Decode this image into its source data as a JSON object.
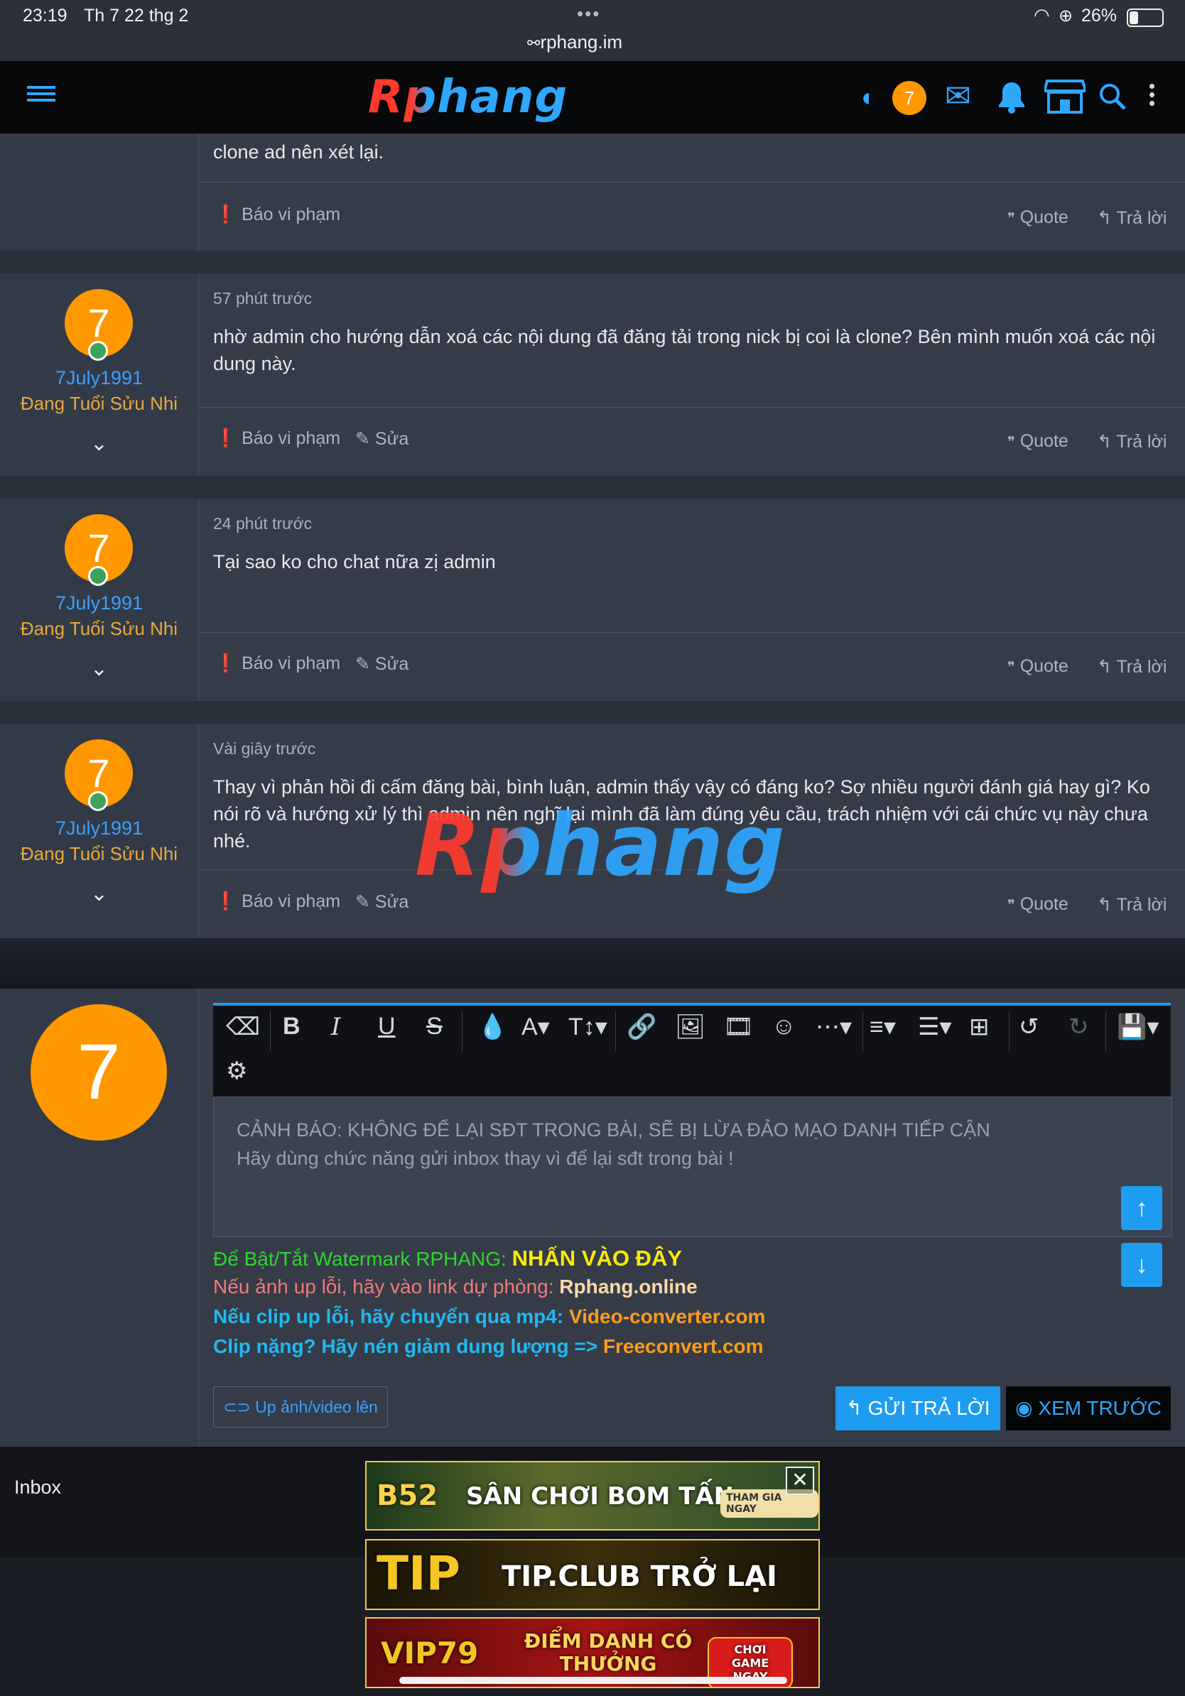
{
  "status_bar": {
    "time": "23:19",
    "date": "Th 7 22 thg 2",
    "url": "rphang.im",
    "battery": "26%"
  },
  "nav": {
    "logo": "Rphang",
    "notification_count": "7"
  },
  "top_post": {
    "content_tail": "clone ad nên xét lại.",
    "report": "Báo vi phạm",
    "quote": "Quote",
    "reply": "Trả lời"
  },
  "posts": [
    {
      "avatar": "7",
      "username": "7July1991",
      "user_title": "Đang Tuổi Sửu Nhi",
      "time": "57 phút trước",
      "content": "nhờ admin cho hướng dẫn xoá các nội dung đã đăng tải trong nick bị coi là clone? Bên mình muốn xoá các nội dung này.",
      "report": "Báo vi phạm",
      "edit": "Sửa",
      "quote": "Quote",
      "reply": "Trả lời"
    },
    {
      "avatar": "7",
      "username": "7July1991",
      "user_title": "Đang Tuổi Sửu Nhi",
      "time": "24 phút trước",
      "content": "Tại sao ko cho chat nữa zị admin",
      "report": "Báo vi phạm",
      "edit": "Sửa",
      "quote": "Quote",
      "reply": "Trả lời"
    },
    {
      "avatar": "7",
      "username": "7July1991",
      "user_title": "Đang Tuổi Sửu Nhi",
      "time": "Vài giây trước",
      "content": "Thay vì phản hồi đi cấm đăng bài, bình luận, admin thấy vậy có đáng ko? Sợ nhiều người đánh giá hay gì? Ko nói rõ và hướng xử lý thì admin nên nghĩ lại mình đã làm đúng yêu cầu, trách nhiệm với cái chức vụ này chưa nhé.",
      "report": "Báo vi phạm",
      "edit": "Sửa",
      "quote": "Quote",
      "reply": "Trả lời"
    }
  ],
  "watermark": "Rphang",
  "editor": {
    "avatar": "7",
    "placeholder_line1": "CẢNH BÁO: KHÔNG ĐỂ LẠI SĐT TRONG BÀI, SẼ BỊ LỪA ĐẢO MẠO DANH TIẾP CẬN",
    "placeholder_line2": "Hãy dùng chức năng gửi inbox thay vì để lại sđt trong bài !"
  },
  "notes": {
    "n1_label": "Để Bật/Tắt Watermark RPHANG:",
    "n1_link": "NHẤN VÀO ĐÂY",
    "n2_label": "Nếu ảnh up lỗi, hãy vào link dự phòng:",
    "n2_link": "Rphang.online",
    "n3_label": "Nếu clip up lỗi, hãy chuyển qua mp4:",
    "n3_link": "Video-converter.com",
    "n4_label": "Clip nặng? Hãy nén giảm dung lượng =>",
    "n4_link": "Freeconvert.com"
  },
  "buttons": {
    "upload": "Up ảnh/video lên",
    "reply": "GỬI TRẢ LỜI",
    "preview": "XEM TRƯỚC"
  },
  "footer": {
    "inbox": "Inbox"
  },
  "banners": [
    {
      "brand": "B52",
      "text": "SÂN CHƠI BOM TẤN",
      "cta": "THAM GIA NGAY"
    },
    {
      "brand": "TIP",
      "text": "TIP.CLUB TRỞ LẠI"
    },
    {
      "brand": "VIP79",
      "text": "ĐIỂM DANH CÓ THƯỞNG",
      "cta": "CHƠI GAME NGAY"
    }
  ],
  "colors": {
    "accent": "#1e9cf0",
    "avatar": "#ff9800",
    "username": "#3aa0ff",
    "user_title": "#e8a83e"
  }
}
